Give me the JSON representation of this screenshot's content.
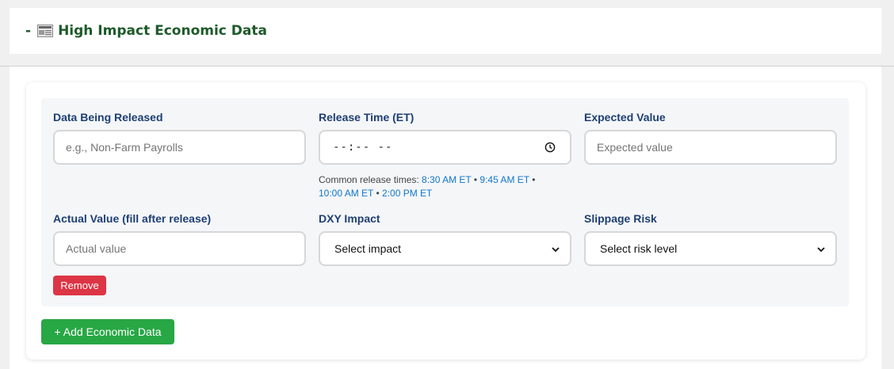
{
  "section": {
    "collapse_symbol": "-",
    "icon": "newspaper-icon",
    "title": "High Impact Economic Data"
  },
  "entry": {
    "data_released": {
      "label": "Data Being Released",
      "placeholder": "e.g., Non-Farm Payrolls",
      "value": ""
    },
    "release_time": {
      "label": "Release Time (ET)",
      "value_display": "--:-- --",
      "hint_prefix": "Common release times: ",
      "common_times": [
        "8:30 AM ET",
        "9:45 AM ET",
        "10:00 AM ET",
        "2:00 PM ET"
      ],
      "separator": " • "
    },
    "expected_value": {
      "label": "Expected Value",
      "placeholder": "Expected value",
      "value": ""
    },
    "actual_value": {
      "label": "Actual Value (fill after release)",
      "placeholder": "Actual value",
      "value": ""
    },
    "dxy_impact": {
      "label": "DXY Impact",
      "selected": "Select impact"
    },
    "slippage_risk": {
      "label": "Slippage Risk",
      "selected": "Select risk level"
    },
    "remove_label": "Remove"
  },
  "add_button_label": "+ Add Economic Data",
  "colors": {
    "title": "#1e5a2a",
    "label": "#1f3f73",
    "link_time": "#1177cc",
    "remove": "#dc3545",
    "add": "#28a745"
  }
}
